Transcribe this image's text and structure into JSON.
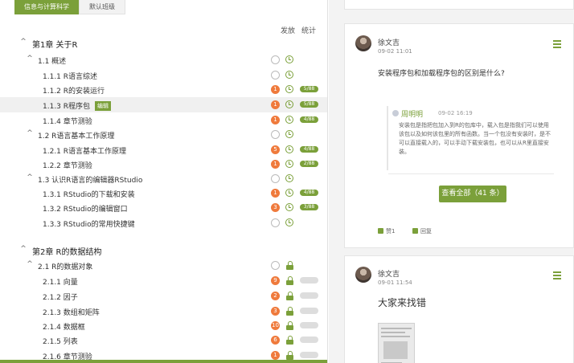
{
  "tabs": [
    {
      "label": "信息与计算科学"
    },
    {
      "label": "默认班级"
    }
  ],
  "columns": {
    "publish": "发放",
    "stats": "统计"
  },
  "tree": [
    {
      "kind": "chap",
      "label": "第1章 关于R",
      "indent": 0
    },
    {
      "kind": "sec",
      "label": "1.1  概述",
      "indent": 1,
      "badge": "ring",
      "status": "clock"
    },
    {
      "kind": "item",
      "label": "1.1.1 R语言综述",
      "indent": 2,
      "badge": "ring",
      "status": "clock"
    },
    {
      "kind": "item",
      "label": "1.1.2 R的安装运行",
      "indent": 2,
      "badge": "1",
      "status": "clock",
      "pill": "5/88"
    },
    {
      "kind": "item",
      "label": "1.1.3 R程序包",
      "indent": 2,
      "badge": "1",
      "status": "clock",
      "pill": "5/88",
      "tag": "编辑",
      "highlight": true
    },
    {
      "kind": "item",
      "label": "1.1.4 章节测验",
      "indent": 2,
      "badge": "1",
      "status": "clock",
      "pill": "4/88"
    },
    {
      "kind": "sec",
      "label": "1.2  R语言基本工作原理",
      "indent": 1,
      "badge": "ring",
      "status": "clock"
    },
    {
      "kind": "item",
      "label": "1.2.1 R语言基本工作原理",
      "indent": 2,
      "badge": "5",
      "status": "clock",
      "pill": "4/88"
    },
    {
      "kind": "item",
      "label": "1.2.2 章节测验",
      "indent": 2,
      "badge": "1",
      "status": "clock",
      "pill": "2/88"
    },
    {
      "kind": "sec",
      "label": "1.3  认识R语言的编辑器RStudio",
      "indent": 1,
      "badge": "ring",
      "status": "clock"
    },
    {
      "kind": "item",
      "label": "1.3.1 RStudio的下载和安装",
      "indent": 2,
      "badge": "1",
      "status": "clock",
      "pill": "4/88"
    },
    {
      "kind": "item",
      "label": "1.3.2 RStudio的编辑窗口",
      "indent": 2,
      "badge": "3",
      "status": "clock",
      "pill": "3/88"
    },
    {
      "kind": "item",
      "label": "1.3.3 RStudio的常用快捷键",
      "indent": 2,
      "badge": "ring",
      "status": "clock"
    },
    {
      "kind": "chap",
      "label": "第2章 R的数据结构",
      "indent": 0
    },
    {
      "kind": "sec",
      "label": "2.1  R的数据对象",
      "indent": 1,
      "badge": "ring",
      "status": "lock"
    },
    {
      "kind": "item",
      "label": "2.1.1 向量",
      "indent": 2,
      "badge": "9",
      "status": "lock",
      "pill": ""
    },
    {
      "kind": "item",
      "label": "2.1.2 因子",
      "indent": 2,
      "badge": "2",
      "status": "lock",
      "pill": ""
    },
    {
      "kind": "item",
      "label": "2.1.3 数组和矩阵",
      "indent": 2,
      "badge": "3",
      "status": "lock",
      "pill": ""
    },
    {
      "kind": "item",
      "label": "2.1.4 数据框",
      "indent": 2,
      "badge": "10",
      "status": "lock",
      "pill": ""
    },
    {
      "kind": "item",
      "label": "2.1.5 列表",
      "indent": 2,
      "badge": "6",
      "status": "lock",
      "pill": ""
    },
    {
      "kind": "item",
      "label": "2.1.6 章节测验",
      "indent": 2,
      "badge": "1",
      "status": "lock",
      "pill": ""
    }
  ],
  "post1": {
    "author": "徐文吉",
    "date": "09-02 11:01",
    "question": "安装程序包和加载程序包的区别是什么?",
    "reply": {
      "author": "周明明",
      "date": "09-02 16:19",
      "text": "安装包是指把包加入到R的包库中，载入包是指我们可以使用该包以及如何该包里的所有函数。当一个包没有安装时，是不可以直接载入的，可以手动下载安装包，也可以从R里直接安装。"
    },
    "view_all": "查看全部（41 条）",
    "like": "赞1",
    "reply_label": "回复"
  },
  "post2": {
    "author": "徐文吉",
    "date": "09-01 11:54",
    "text": "大家来找错"
  },
  "colors": {
    "accent": "#7ba03a",
    "badge": "#ef7a3c"
  }
}
